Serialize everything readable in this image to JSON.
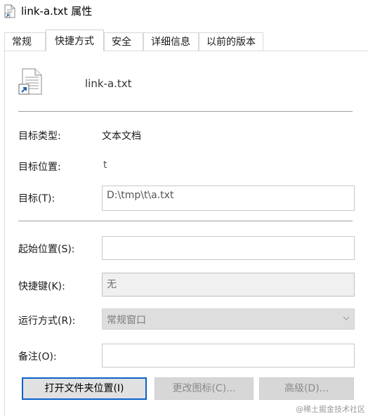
{
  "window": {
    "title": "link-a.txt 属性"
  },
  "tabs": [
    {
      "label": "常规"
    },
    {
      "label": "快捷方式",
      "active": true
    },
    {
      "label": "安全"
    },
    {
      "label": "详细信息"
    },
    {
      "label": "以前的版本"
    }
  ],
  "header": {
    "file_name": "link-a.txt"
  },
  "info": {
    "target_type_label": "目标类型:",
    "target_type_value": "文本文档",
    "target_location_label": "目标位置:",
    "target_location_value": "t"
  },
  "fields": {
    "target_label": "目标(T):",
    "target_value": "D:\\tmp\\t\\a.txt",
    "start_in_label": "起始位置(S):",
    "start_in_value": "",
    "shortcut_key_label": "快捷键(K):",
    "shortcut_key_value": "无",
    "run_label": "运行方式(R):",
    "run_value": "常规窗口",
    "comment_label": "备注(O):",
    "comment_value": ""
  },
  "buttons": {
    "open_location": "打开文件夹位置(I)",
    "change_icon": "更改图标(C)...",
    "advanced": "高级(D)..."
  },
  "watermark": "@稀土掘金技术社区"
}
